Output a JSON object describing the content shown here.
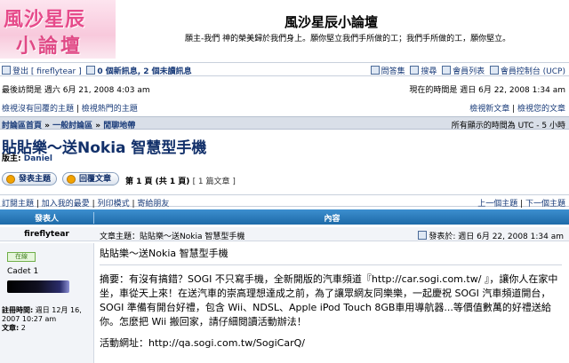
{
  "header": {
    "logo_line1": "風沙星辰",
    "logo_line2": "小論壇",
    "site_title": "風沙星辰小論壇",
    "site_desc": "願主-我們 神的榮美歸於我們身上。願你堅立我們手所做的工；我們手所做的工，願你堅立。"
  },
  "nav": {
    "logout": "登出 [ fireflytear ]",
    "pm": "0 個新訊息, 2 個未讀訊息",
    "faq": "問答集",
    "search": "搜尋",
    "members": "會員列表",
    "ucp": "會員控制台 (UCP)"
  },
  "visit": {
    "last_visit": "最後訪問是 週六 6月 21, 2008 4:03 am",
    "current_time": "現在的時間是 週日 6月 22, 2008 1:34 am"
  },
  "links": {
    "unanswered": "檢視沒有回覆的主題",
    "active": "檢視熱門的主題",
    "new_posts": "檢視新文章",
    "your_posts": "檢視您的文章"
  },
  "breadcrumb": {
    "items": [
      "討論區首頁",
      "一般討論區",
      "閒聊地帶"
    ],
    "sep": " » ",
    "timezone": "所有顯示的時間為 UTC - 5 小時"
  },
  "topic": {
    "title": "貼貼樂～送Nokia 智慧型手機",
    "moderator_label": "版主:",
    "moderator": "Daniel"
  },
  "buttons": {
    "post": "發表主題",
    "reply": "回覆文章",
    "page": "第 1 頁 (共 1 頁)",
    "count": "[ 1 篇文章 ]"
  },
  "tools": {
    "subscribe": "訂閱主題",
    "bookmark": "加入我的最愛",
    "print": "列印模式",
    "email": "寄給朋友",
    "prev": "上一個主題",
    "next": "下一個主題"
  },
  "table": {
    "col_author": "發表人",
    "col_content": "內容"
  },
  "post": {
    "author": "fireflytear",
    "subject": "文章主題：貼貼樂～送Nokia 智慧型手機",
    "date": "發表於: 週日 6月 22, 2008 1:34 am",
    "online": "在線",
    "rank": "Cadet 1",
    "joined_label": "註冊時間:",
    "joined": "週日 12月 16, 2007 10:27 am",
    "posts_label": "文章:",
    "posts": "2",
    "body_subject": "貼貼樂～送Nokia 智慧型手機",
    "body_text": "摘要：有沒有搞錯？SOGI 不只寫手機，全新開版的汽車頻道『http://car.sogi.com.tw/ 』，讓你人在家中坐，車從天上來！在送汽車的崇高理想達成之前，為了讓眾網友同樂樂，一起慶祝 SOGI 汽車頻道開台，SOGI 準備有開台好禮，包含 Wii、NDSL、Apple iPod Touch 8GB車用導航器...等價值數萬的好禮送給你。怎麼把 Wii 搬回家，請仔細閱讀活動辦法！",
    "body_link": "活動網址：http://qa.sogi.com.tw/SogiCarQ/"
  }
}
